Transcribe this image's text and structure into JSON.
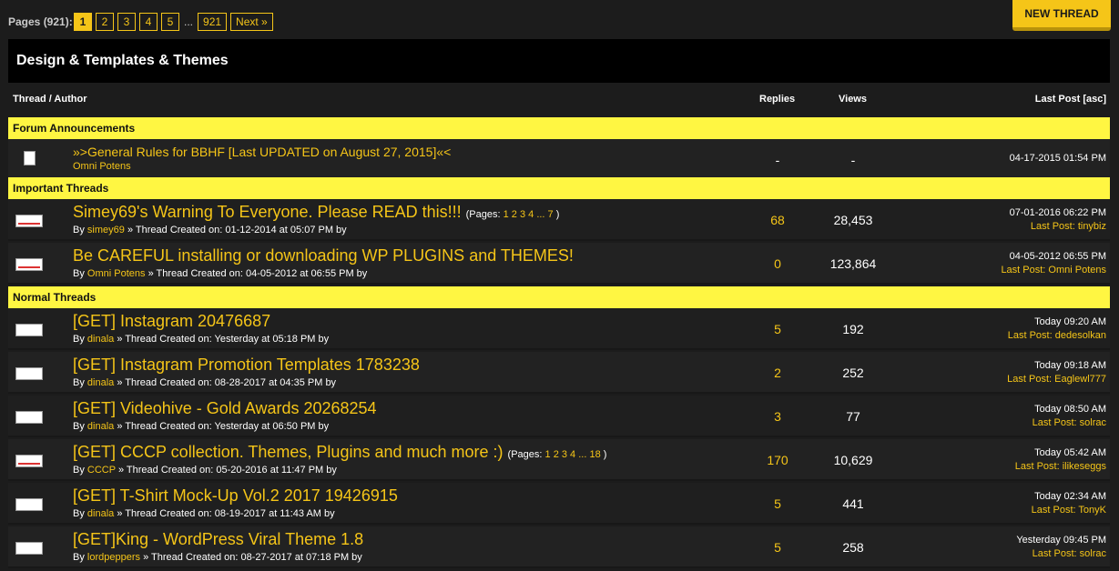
{
  "pagination": {
    "label": "Pages (921):",
    "pages": [
      "1",
      "2",
      "3",
      "4",
      "5"
    ],
    "ellipsis": "...",
    "last": "921",
    "next": "Next »"
  },
  "new_thread_label": "NEW THREAD",
  "forum_title": "Design & Templates & Themes",
  "columns": {
    "thread_author": "Thread / Author",
    "replies": "Replies",
    "views": "Views",
    "last_post": "Last Post [asc]"
  },
  "sections": {
    "announcements": "Forum Announcements",
    "important": "Important Threads",
    "normal": "Normal Threads"
  },
  "threads": [
    {
      "title": "»>General Rules for BBHF [Last UPDATED on August 27, 2015]«<",
      "author": "Omni Potens",
      "created_prefix": "",
      "created": "",
      "suffix": "",
      "pages": "",
      "replies": "-",
      "views": "-",
      "last_time": "04-17-2015 01:54 PM",
      "last_by": ""
    },
    {
      "title": "Simey69's Warning To Everyone. Please READ this!!!",
      "pages_label": "(Pages:",
      "pages": "1 2 3 4 ... 7",
      "pages_close": ")",
      "author": "simey69",
      "created": "» Thread Created on: 01-12-2014 at 05:07 PM by",
      "replies": "68",
      "views": "28,453",
      "last_time": "07-01-2016 06:22 PM",
      "last_by": "Last Post: tinybiz"
    },
    {
      "title": "Be CAREFUL installing or downloading WP PLUGINS and THEMES!",
      "author": "Omni Potens",
      "created": "» Thread Created on: 04-05-2012 at 06:55 PM by",
      "replies": "0",
      "views": "123,864",
      "last_time": "04-05-2012 06:55 PM",
      "last_by": "Last Post: Omni Potens"
    },
    {
      "title": "[GET] Instagram 20476687",
      "author": "dinala",
      "created": "» Thread Created on: Yesterday at 05:18 PM by",
      "replies": "5",
      "views": "192",
      "last_time": "Today 09:20 AM",
      "last_by": "Last Post: dedesolkan"
    },
    {
      "title": "[GET] Instagram Promotion Templates 1783238",
      "author": "dinala",
      "created": "» Thread Created on: 08-28-2017 at 04:35 PM by",
      "replies": "2",
      "views": "252",
      "last_time": "Today 09:18 AM",
      "last_by": "Last Post: Eaglewl777"
    },
    {
      "title": "[GET] Videohive - Gold Awards 20268254",
      "author": "dinala",
      "created": "» Thread Created on: Yesterday at 06:50 PM by",
      "replies": "3",
      "views": "77",
      "last_time": "Today 08:50 AM",
      "last_by": "Last Post: solrac"
    },
    {
      "title": "[GET] CCCP collection. Themes, Plugins and much more :)",
      "pages_label": "(Pages:",
      "pages": "1 2 3 4 ... 18",
      "pages_close": ")",
      "author": "CCCP",
      "created": "» Thread Created on: 05-20-2016 at 11:47 PM by",
      "replies": "170",
      "views": "10,629",
      "last_time": "Today 05:42 AM",
      "last_by": "Last Post: ilikeseggs"
    },
    {
      "title": "[GET] T-Shirt Mock-Up Vol.2 2017 19426915",
      "author": "dinala",
      "created": "» Thread Created on: 08-19-2017 at 11:43 AM by",
      "replies": "5",
      "views": "441",
      "last_time": "Today 02:34 AM",
      "last_by": "Last Post: TonyK"
    },
    {
      "title": "[GET]King - WordPress Viral Theme 1.8",
      "author": "lordpeppers",
      "created": "» Thread Created on: 08-27-2017 at 07:18 PM by",
      "replies": "5",
      "views": "258",
      "last_time": "Yesterday 09:45 PM",
      "last_by": "Last Post: solrac"
    }
  ],
  "colors": {
    "accent": "#f5c518",
    "section_bg": "#fff642",
    "header_bg": "#000000",
    "row_bg": "#222222"
  }
}
